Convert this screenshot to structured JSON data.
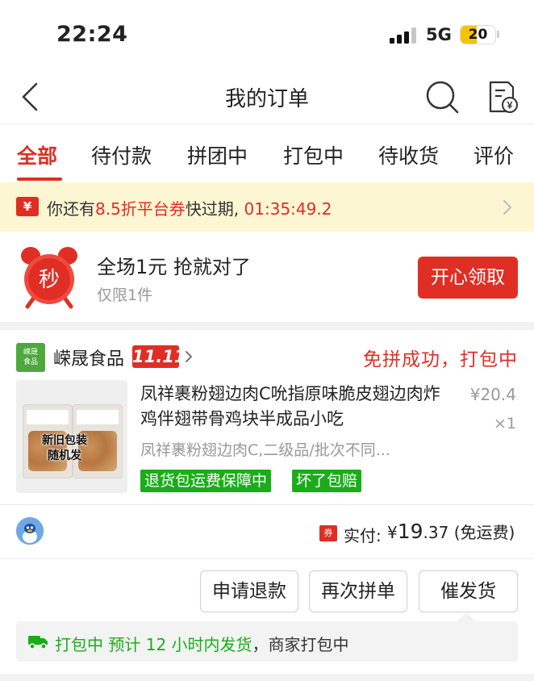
{
  "status_bar": {
    "time": "22:24",
    "network": "5G",
    "battery": "20",
    "battery_level": 0.2
  },
  "nav": {
    "title": "我的订单",
    "back_icon": "chevron-left-icon",
    "search_icon": "search-icon",
    "bill_icon": "bill-icon"
  },
  "tabs": [
    {
      "label": "全部",
      "active": true
    },
    {
      "label": "待付款"
    },
    {
      "label": "拼团中"
    },
    {
      "label": "打包中"
    },
    {
      "label": "待收货"
    },
    {
      "label": "评价"
    }
  ],
  "coupon_banner": {
    "icon_glyph": "¥",
    "prefix": "你还有",
    "highlight": "8.5折平台券",
    "middle": "快过期, ",
    "countdown": "01:35:49.2"
  },
  "promo": {
    "icon_glyph": "秒",
    "title": "全场1元 抢就对了",
    "subtitle": "仅限1件",
    "button_label": "开心领取"
  },
  "order": {
    "store_logo_text": "嵘晟\n食品",
    "store_name": "嵘晟食品",
    "store_badge": "11.11",
    "status": "免拼成功，打包中",
    "product_image_caption": "新旧包装\n随机发",
    "product_title": "凤祥裹粉翅边肉C吮指原味脆皮翅边肉炸鸡伴翅带骨鸡块半成品小吃",
    "price": "¥20.4",
    "quantity": "×1",
    "spec": "凤祥裹粉翅边肉C,二级品/批次不同...",
    "tags": [
      "退货包运费保障中",
      "坏了包赔"
    ],
    "pay_icon_text": "券",
    "pay_label": "实付:",
    "pay_currency": "¥",
    "pay_int": "19",
    "pay_dec": ".37",
    "pay_note": "(免运费)",
    "buttons": [
      "申请退款",
      "再次拼单",
      "催发货"
    ],
    "shipping_status": "打包中",
    "shipping_eta": "预计 12 小时内发货",
    "shipping_note": "，商家打包中"
  },
  "colors": {
    "accent": "#e02e24",
    "green": "#1aad19",
    "coupon_bg": "#fdf6d2"
  }
}
